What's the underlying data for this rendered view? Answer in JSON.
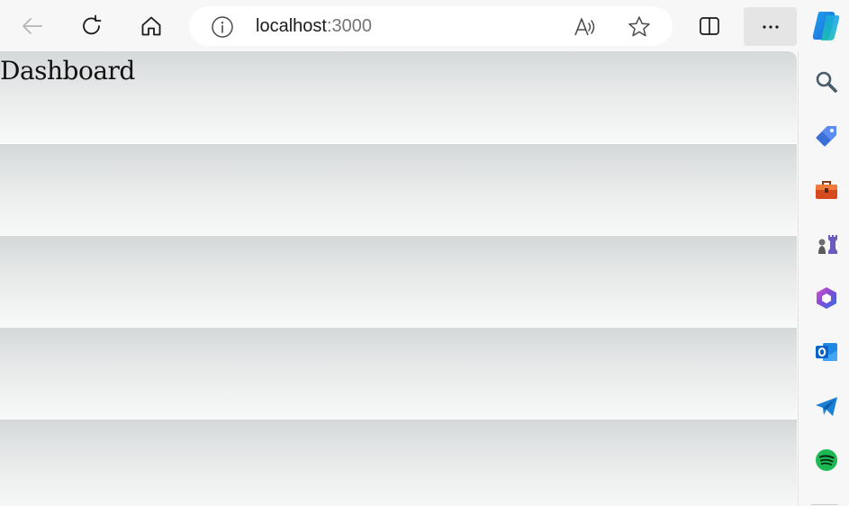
{
  "toolbar": {
    "back_icon": "arrow-left-icon",
    "refresh_icon": "refresh-icon",
    "home_icon": "home-icon",
    "split_icon": "split-screen-icon",
    "more_label": "···"
  },
  "address_bar": {
    "host": "localhost",
    "port": ":3000",
    "info_icon": "info-icon",
    "read_aloud_icon": "read-aloud-icon",
    "favorite_icon": "star-icon"
  },
  "sidebar": {
    "items": [
      {
        "name": "search",
        "icon": "search-icon",
        "color": "#4a5b6b"
      },
      {
        "name": "shopping",
        "icon": "price-tag-icon",
        "color": "#3b6fd8"
      },
      {
        "name": "tools",
        "icon": "toolbox-icon",
        "color": "#d64a1f"
      },
      {
        "name": "games",
        "icon": "chess-pieces-icon",
        "color": "#6b5bbf"
      },
      {
        "name": "microsoft-365",
        "icon": "m365-icon",
        "color": "#7b4fd6"
      },
      {
        "name": "outlook",
        "icon": "outlook-icon",
        "color": "#0a64c8"
      },
      {
        "name": "telegram",
        "icon": "paper-plane-icon",
        "color": "#1b7fd6"
      },
      {
        "name": "spotify",
        "icon": "spotify-icon",
        "color": "#1db954"
      }
    ]
  },
  "page": {
    "title": "Dashboard"
  },
  "colors": {
    "band_top": "#d5d8d9",
    "band_bottom": "#f8f9f9",
    "chrome": "#f7f7f7"
  }
}
